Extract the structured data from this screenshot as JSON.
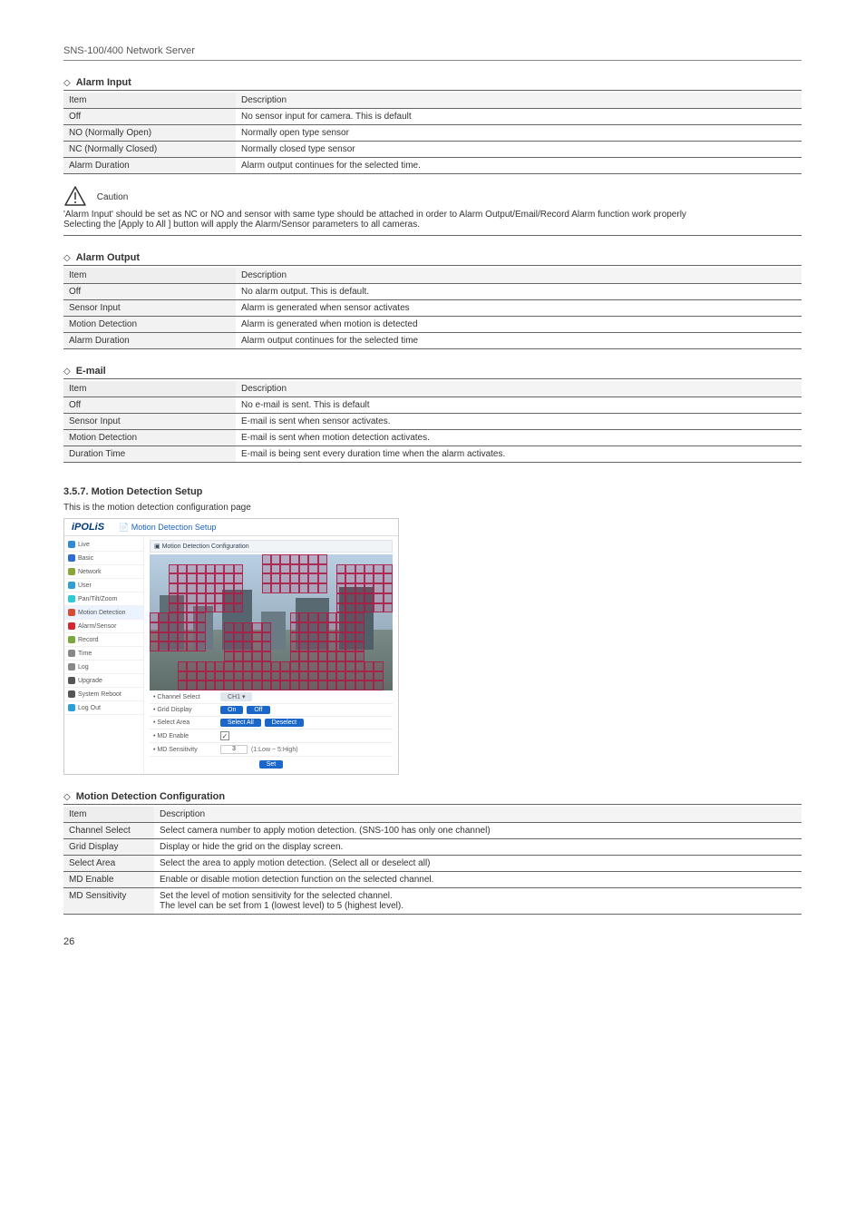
{
  "header": "SNS-100/400 Network Server",
  "sections": [
    {
      "title": "Alarm Input",
      "col1w": "190px",
      "headers": [
        "Item",
        "Description"
      ],
      "rows": [
        [
          "Off",
          "No sensor input for camera. This is default"
        ],
        [
          "NO (Normally Open)",
          "Normally open type sensor"
        ],
        [
          "NC (Normally Closed)",
          "Normally closed type sensor"
        ],
        [
          "Alarm Duration",
          "Alarm output continues for the selected time."
        ]
      ]
    },
    {
      "title": "Alarm Output",
      "col1w": "190px",
      "headers": [
        "Item",
        "Description"
      ],
      "rows": [
        [
          "Off",
          "No alarm output. This is default."
        ],
        [
          "Sensor Input",
          "Alarm is generated when sensor activates"
        ],
        [
          "Motion Detection",
          "Alarm is generated when motion is detected"
        ],
        [
          "Alarm Duration",
          "Alarm output continues for the selected time"
        ]
      ]
    },
    {
      "title": "E-mail",
      "col1w": "190px",
      "headers": [
        "Item",
        "Description"
      ],
      "rows": [
        [
          "Off",
          "No e-mail is sent. This is default"
        ],
        [
          "Sensor Input",
          "E-mail is sent when sensor activates."
        ],
        [
          "Motion Detection",
          "E-mail is sent when motion detection activates."
        ],
        [
          "Duration Time",
          "E-mail is being sent every duration time when the alarm activates."
        ]
      ]
    },
    {
      "title": "Motion Detection Configuration",
      "col1w": "100px",
      "headers": [
        "Item",
        "Description"
      ],
      "rows": [
        [
          "Channel Select",
          "Select camera number to apply motion detection. (SNS-100 has only one channel)"
        ],
        [
          "Grid Display",
          "Display or hide the grid on the display screen."
        ],
        [
          "Select Area",
          "Select the area to apply motion detection. (Select all or deselect all)"
        ],
        [
          "MD Enable",
          "Enable or disable motion detection function on the selected channel."
        ],
        [
          "MD Sensitivity",
          "Set the level of motion sensitivity for the selected channel.\nThe level can be set from 1 (lowest level) to 5 (highest level)."
        ]
      ]
    }
  ],
  "caution": {
    "label": "Caution",
    "text": "'Alarm Input' should be set as NC or NO and sensor with same type should be attached in order to Alarm Output/Email/Record Alarm function work properly",
    "apply_to_all": "Selecting the [Apply to All ] button will apply the Alarm/Sensor parameters to all cameras."
  },
  "md_heading": "3.5.7. Motion Detection Setup",
  "md_intro": "This is the motion detection configuration page",
  "screenshot": {
    "logo": "iPOLiS",
    "title": "Motion Detection Setup",
    "subtitle": "Motion Detection Configuration",
    "nav": [
      "Live",
      "Basic",
      "Network",
      "User",
      "Pan/Tilt/Zoom",
      "Motion Detection",
      "Alarm/Sensor",
      "Record",
      "Time",
      "Log",
      "Upgrade",
      "System Reboot",
      "Log Out"
    ],
    "nav_active": 5,
    "rows": {
      "channel_label": "• Channel Select",
      "channel_value": "CH1",
      "grid_label": "• Grid Display",
      "grid_on": "On",
      "grid_off": "Off",
      "sel_label": "• Select Area",
      "sel_all": "Select All",
      "deselect": "Deselect",
      "md_enable_label": "• MD Enable",
      "md_sens_label": "• MD Sensitivity",
      "md_sens_val": "3",
      "md_sens_hint": "(1:Low ~ 5:High)",
      "set": "Set"
    }
  },
  "page_number": "26"
}
